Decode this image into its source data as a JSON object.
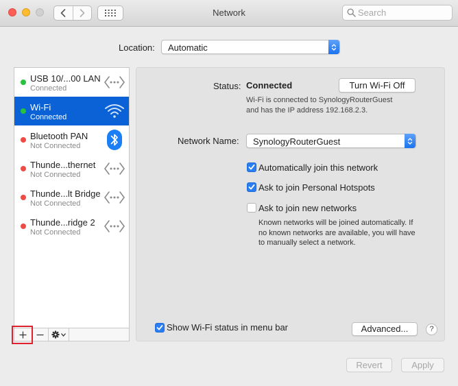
{
  "window": {
    "title": "Network"
  },
  "search": {
    "placeholder": "Search",
    "value": ""
  },
  "location": {
    "label": "Location:",
    "value": "Automatic"
  },
  "services": [
    {
      "name": "USB 10/...00 LAN",
      "status": "Connected",
      "color": "#27c23e",
      "icon": "ethernet-icon",
      "selected": false
    },
    {
      "name": "Wi-Fi",
      "status": "Connected",
      "color": "#27c23e",
      "icon": "wifi-icon",
      "selected": true
    },
    {
      "name": "Bluetooth PAN",
      "status": "Not Connected",
      "color": "#ee4b45",
      "icon": "bluetooth-icon",
      "selected": false
    },
    {
      "name": "Thunde...thernet",
      "status": "Not Connected",
      "color": "#ee4b45",
      "icon": "ethernet-icon",
      "selected": false
    },
    {
      "name": "Thunde...lt Bridge",
      "status": "Not Connected",
      "color": "#ee4b45",
      "icon": "ethernet-icon",
      "selected": false
    },
    {
      "name": "Thunde...ridge 2",
      "status": "Not Connected",
      "color": "#ee4b45",
      "icon": "ethernet-icon",
      "selected": false
    }
  ],
  "sidebar_actions": {
    "add": "+",
    "remove": "—"
  },
  "status": {
    "label": "Status:",
    "value": "Connected",
    "button": "Turn Wi-Fi Off",
    "desc_line1": "Wi-Fi is connected to SynologyRouterGuest",
    "desc_line2": "and has the IP address 192.168.2.3."
  },
  "network_name": {
    "label": "Network Name:",
    "value": "SynologyRouterGuest"
  },
  "options": {
    "auto_join": {
      "label": "Automatically join this network",
      "checked": true
    },
    "hotspots": {
      "label": "Ask to join Personal Hotspots",
      "checked": true
    },
    "new_networks": {
      "label": "Ask to join new networks",
      "checked": false
    },
    "note_line1": "Known networks will be joined automatically. If",
    "note_line2": "no known networks are available, you will have",
    "note_line3": "to manually select a network."
  },
  "menu_bar": {
    "label": "Show Wi-Fi status in menu bar",
    "checked": true
  },
  "buttons": {
    "advanced": "Advanced...",
    "help": "?",
    "revert": "Revert",
    "apply": "Apply"
  },
  "colors": {
    "accent": "#0a62d6",
    "connected": "#27c23e",
    "not_connected": "#ee4b45"
  }
}
